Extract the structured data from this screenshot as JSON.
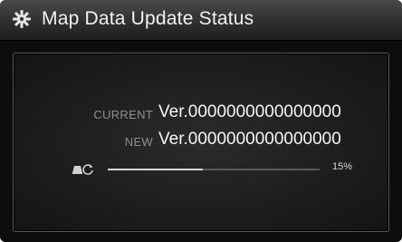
{
  "header": {
    "title": "Map Data Update Status",
    "icon": "gear-icon"
  },
  "status": {
    "current_label": "CURRENT",
    "current_value": "Ver.0000000000000000",
    "new_label": "NEW",
    "new_value": "Ver.0000000000000000"
  },
  "progress": {
    "icon": "update-icon",
    "percent_text": "15%",
    "fraction": 0.45
  },
  "colors": {
    "background": "#0d0d0d",
    "title_bar": "#3a3a3a",
    "label": "#8f8f8f",
    "value": "#f5f5f5",
    "track": "#5a5a5a",
    "fill": "#d8d8d8"
  }
}
